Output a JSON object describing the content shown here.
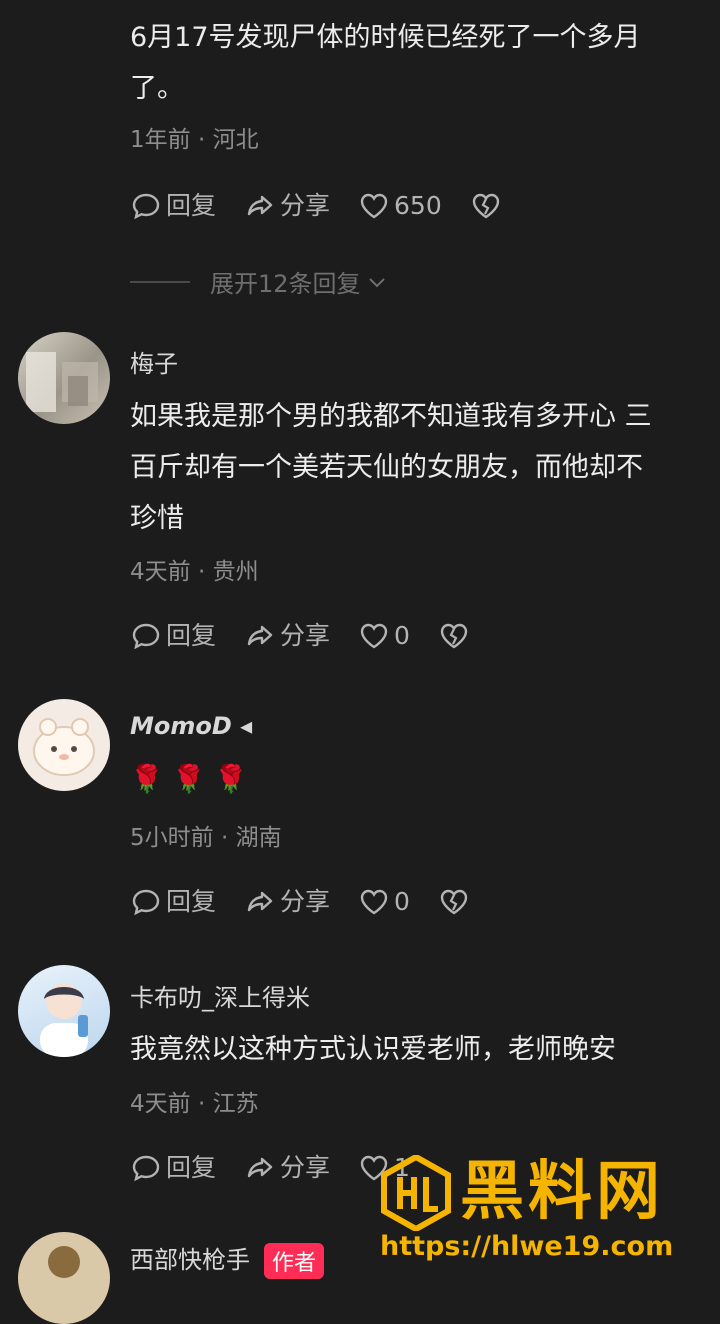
{
  "comments": [
    {
      "text_lines": [
        "6月17号发现尸体的时候已经死了一个多月",
        "了。"
      ],
      "meta": "1年前 · 河北",
      "reply_label": "回复",
      "share_label": "分享",
      "likes": "650",
      "expand_label": "展开12条回复"
    },
    {
      "username": "梅子",
      "text_lines": [
        "如果我是那个男的我都不知道我有多开心 三",
        "百斤却有一个美若天仙的女朋友，而他却不",
        "珍惜"
      ],
      "meta": "4天前 · 贵州",
      "reply_label": "回复",
      "share_label": "分享",
      "likes": "0"
    },
    {
      "username": "MomoD ◂",
      "text_lines": [
        "🌹 🌹 🌹"
      ],
      "meta": "5小时前 · 湖南",
      "reply_label": "回复",
      "share_label": "分享",
      "likes": "0"
    },
    {
      "username": "卡布叻_深上得米",
      "text_lines": [
        "我竟然以这种方式认识爱老师，老师晚安"
      ],
      "meta": "4天前 · 江苏",
      "reply_label": "回复",
      "share_label": "分享",
      "likes": "1"
    },
    {
      "username": "西部快枪手",
      "badge": "作者"
    }
  ],
  "watermark": {
    "title": "黑料网",
    "url": "https://hlwe19.com",
    "color": "#f5b400"
  },
  "icons": {
    "reply": "comment-bubble-icon",
    "share": "share-arrow-icon",
    "like": "heart-icon",
    "dislike": "broken-heart-icon",
    "expand": "chevron-down-icon"
  }
}
